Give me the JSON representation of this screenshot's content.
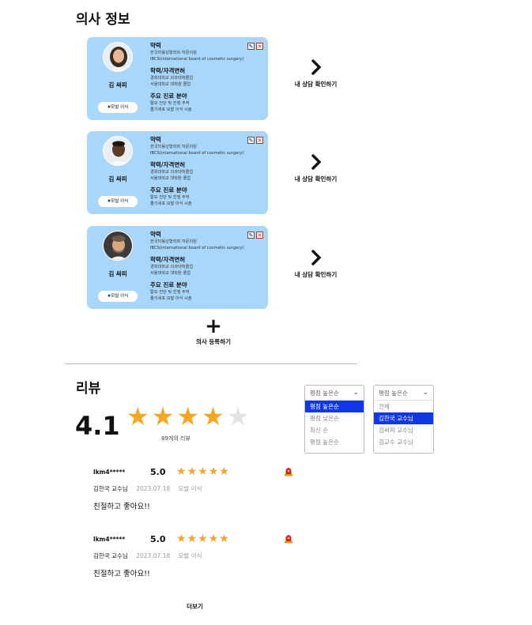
{
  "doctor_section": {
    "title": "의사 정보"
  },
  "doctors": [
    {
      "name": "김 싸피",
      "tag": "#모발 이식",
      "avatar": "woman-portrait",
      "career_title": "약력",
      "career": [
        "한국미용성형학회 자문의원",
        "IBCS(international board of cosmetic surgery)"
      ],
      "education_title": "학력/자격면허",
      "education": [
        "경희대학교 의과대학졸업",
        "서울대학교 대학원 졸업"
      ],
      "specialty_title": "주요 진료 분야",
      "specialty": [
        "탈모 진단 및 진행 추적",
        "줄기세포 모발 이식 시술"
      ],
      "consult_label": "내 상담 확인하기"
    },
    {
      "name": "김 싸피",
      "tag": "#모발 이식",
      "avatar": "man-portrait",
      "career_title": "약력",
      "career": [
        "한국미용성형학회 자문의원",
        "IBCS(international board of cosmetic surgery)"
      ],
      "education_title": "학력/자격면허",
      "education": [
        "경희대학교 의과대학졸업",
        "서울대학교 대학원 졸업"
      ],
      "specialty_title": "주요 진료 분야",
      "specialty": [
        "탈모 진단 및 진행 추적",
        "줄기세포 모발 이식 시술"
      ],
      "consult_label": "내 상담 확인하기"
    },
    {
      "name": "김 싸피",
      "tag": "#모발 이식",
      "avatar": "man-portrait-beard",
      "career_title": "약력",
      "career": [
        "한국미용성형학회 자문의원",
        "IBCS(international board of cosmetic surgery)"
      ],
      "education_title": "학력/자격면허",
      "education": [
        "경희대학교 의과대학졸업",
        "서울대학교 대학원 졸업"
      ],
      "specialty_title": "주요 진료 분야",
      "specialty": [
        "탈모 진단 및 진행 추적",
        "줄기세포 모발 이식 시술"
      ],
      "consult_label": "내 상담 확인하기"
    }
  ],
  "add_doctor": {
    "icon": "plus-icon",
    "label": "의사 등록하기"
  },
  "review_section": {
    "title": "리뷰",
    "average": "4.1",
    "rating_value": 4.1,
    "rating_max": 5,
    "count_label": "89개의 리뷰"
  },
  "sort_dropdown": {
    "selected": "평점 높은순",
    "options": [
      "평점 높은순",
      "평점 낮은순",
      "최신 순",
      "평점 높은순"
    ],
    "highlighted_index": 0
  },
  "doctor_dropdown": {
    "selected": "평점 높은순",
    "options": [
      "전체",
      "김한국 교수님",
      "김싸피 교수님",
      "김교수 교수님"
    ],
    "highlighted_index": 1
  },
  "reviews": [
    {
      "user": "lkm4*****",
      "score": "5.0",
      "stars": 5,
      "doctor": "김한국 교수님",
      "date": "2023.07.18",
      "type": "모발 이식",
      "text": "친절하고 좋아요!!"
    },
    {
      "user": "lkm4*****",
      "score": "5.0",
      "stars": 5,
      "doctor": "김한국 교수님",
      "date": "2023.07.18",
      "type": "모발 이식",
      "text": "친절하고 좋아요!!"
    }
  ],
  "more_label": "더보기",
  "colors": {
    "card_bg": "#a9d7fb",
    "star": "#f6a623",
    "dropdown_highlight": "#1237e6",
    "delete_icon": "#e02020"
  }
}
